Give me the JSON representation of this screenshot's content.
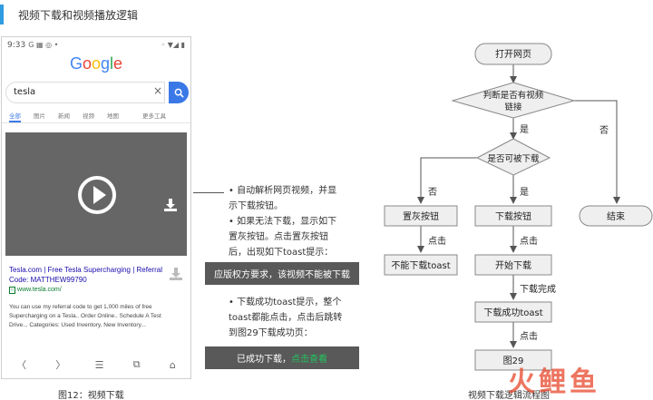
{
  "header": {
    "title": "视频下载和视频播放逻辑"
  },
  "phone": {
    "status": {
      "time": "9:33",
      "left_icons": "G ▦ ◎ •",
      "right_icons": "◦ ▼◢ ▮"
    },
    "logo": {
      "letters": [
        "G",
        "o",
        "o",
        "g",
        "l",
        "e"
      ],
      "colors": [
        "#4285F4",
        "#EA4335",
        "#FBBC05",
        "#4285F4",
        "#34A853",
        "#EA4335"
      ]
    },
    "search": {
      "value": "tesla",
      "clear": "×"
    },
    "tabs": [
      "全部",
      "图片",
      "新闻",
      "视频",
      "地图",
      "更多工具"
    ],
    "result": {
      "title_line1": "Tesla.com | Free Tesla Supercharging | Referral",
      "title_line2": "Code: MATTHEW99790",
      "url": "www.tesla.com/",
      "snippet_line1": "You can use my referral code to get 1,000 miles of free",
      "snippet_line2": "Supercharging on a Tesla.. Order Online.. Schedule A Test",
      "snippet_line3": "Drive... Categories: Used Inventory, New Inventory..."
    },
    "nav": [
      "〈",
      "〉",
      "☰",
      "⧉",
      "⌂"
    ]
  },
  "captions": {
    "left": "图12：视频下载",
    "right": "视频下载逻辑流程图"
  },
  "description": {
    "para1_line1": "• 自动解析网页视频，并显",
    "para1_line2": "示下载按钮。",
    "para2_line1": "• 如果无法下载，显示如下",
    "para2_line2": "置灰按钮。点击置灰按钮",
    "para2_line3": "后，出现如下toast提示：",
    "toast1": "应版权方要求，该视频不能被下载",
    "para3_line1": "• 下载成功toast提示，整个",
    "para3_line2": "toast都能点击，点击后跳转",
    "para3_line3": "到图29下载成功页：",
    "toast2_prefix": "已成功下载，",
    "toast2_link": "点击查看"
  },
  "flowchart": {
    "start": "打开网页",
    "decision1_line1": "判断是否有视频",
    "decision1_line2": "链接",
    "yes": "是",
    "no": "否",
    "decision2": "是否可被下载",
    "gray_button": "置灰按钮",
    "download_button": "下载按钮",
    "end": "结束",
    "click": "点击",
    "cannot_download": "不能下载toast",
    "start_download": "开始下载",
    "download_done": "下载完成",
    "download_success": "下载成功toast",
    "figure29": "图29"
  },
  "watermark": "火鲤鱼",
  "colors": {
    "accent": "#2f9be0",
    "node_fill": "#efefef",
    "node_stroke": "#888888",
    "toast_bg": "#595959",
    "link_green": "#22c55e"
  }
}
